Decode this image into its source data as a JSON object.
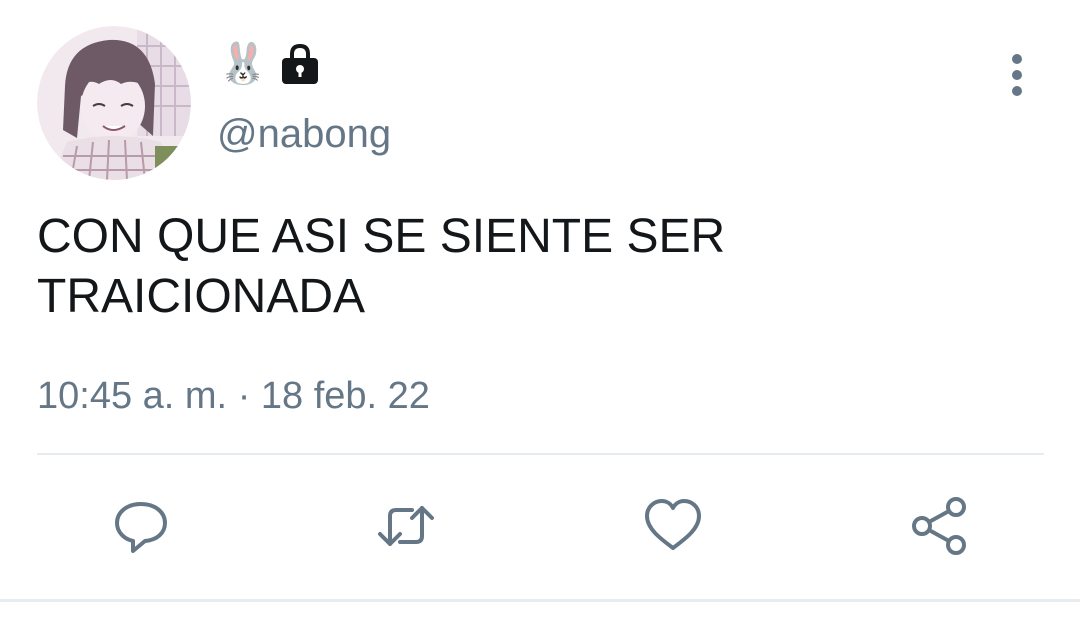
{
  "author": {
    "display_name_emoji": "🐰",
    "locked_icon": "lock-icon",
    "handle": "@nabong",
    "avatar_icon": "anime-girl-avatar"
  },
  "header": {
    "more_icon": "vertical-ellipsis-icon"
  },
  "tweet": {
    "text": "CON QUE ASI SE SIENTE SER\nTRAICIONADA",
    "time": "10:45 a. m.",
    "separator": "·",
    "date": "18 feb. 22"
  },
  "actions": [
    {
      "name": "reply",
      "icon": "reply-icon"
    },
    {
      "name": "retweet",
      "icon": "retweet-icon"
    },
    {
      "name": "like",
      "icon": "heart-icon"
    },
    {
      "name": "share",
      "icon": "share-icon"
    }
  ],
  "colors": {
    "text_primary": "#14171a",
    "text_secondary": "#657786",
    "icon": "#657786",
    "divider": "#e6ecf0"
  }
}
